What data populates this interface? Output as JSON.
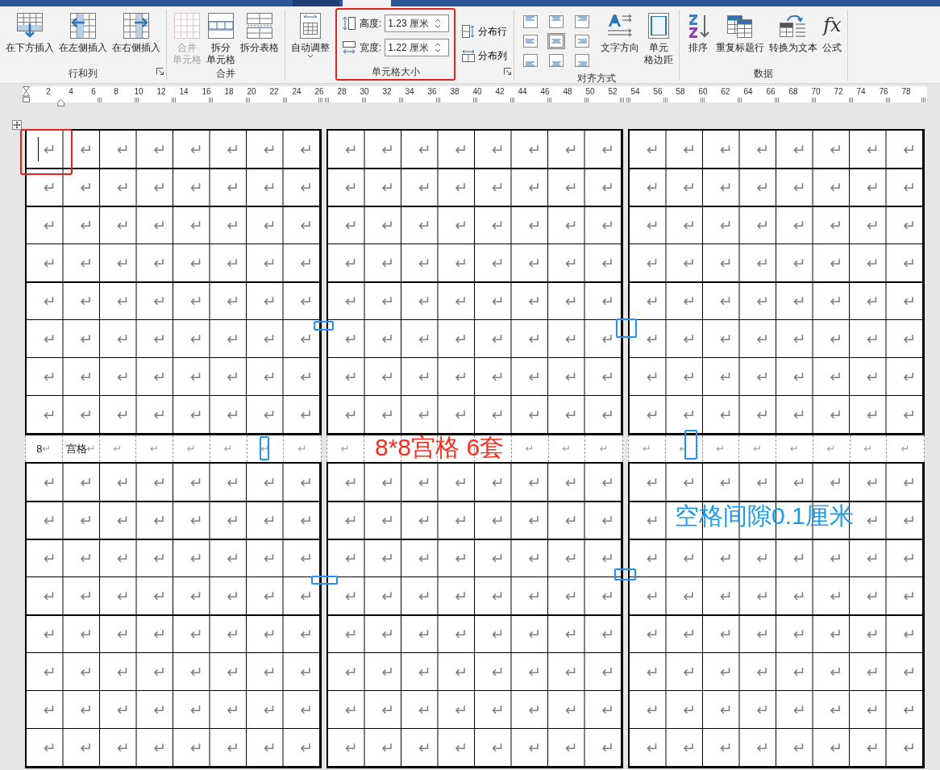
{
  "tab_strip": {
    "tabs": [
      {
        "selected": false
      },
      {
        "selected": true
      }
    ]
  },
  "ribbon": {
    "groups": [
      {
        "kind": "buttons",
        "label": "行和列",
        "launcher": true,
        "buttons": [
          {
            "kind": "insert_below",
            "label": "在下方插入",
            "disabled": false
          },
          {
            "kind": "insert_left",
            "label": "在左侧插入",
            "disabled": false
          },
          {
            "kind": "insert_right",
            "label": "在右侧插入",
            "disabled": false
          }
        ]
      },
      {
        "kind": "buttons",
        "label": "合并",
        "buttons": [
          {
            "kind": "merge",
            "label": [
              "合并",
              "单元格"
            ],
            "disabled": true
          },
          {
            "kind": "split_cells",
            "label": [
              "拆分",
              "单元格"
            ],
            "disabled": false
          },
          {
            "kind": "split_table",
            "label": "拆分表格",
            "disabled": false
          }
        ]
      },
      {
        "kind": "cell_size",
        "label": "单元格大小",
        "launcher": true,
        "highlighted": true,
        "autofit": {
          "kind": "autofit",
          "label": "自动调整",
          "disabled": false
        },
        "fields": [
          {
            "kind": "height",
            "label": "高度:",
            "value": "1.23 厘米"
          },
          {
            "kind": "width",
            "label": "宽度:",
            "value": "1.22 厘米"
          }
        ],
        "distribute": [
          {
            "kind": "rows",
            "label": "分布行"
          },
          {
            "kind": "cols",
            "label": "分布列"
          }
        ]
      },
      {
        "kind": "alignment",
        "label": "对齐方式",
        "align_buttons": [
          {
            "selected": false
          },
          {
            "selected": false
          },
          {
            "selected": false
          },
          {
            "selected": false
          },
          {
            "selected": true
          },
          {
            "selected": false
          },
          {
            "selected": false
          },
          {
            "selected": false
          },
          {
            "selected": false
          }
        ],
        "buttons": [
          {
            "kind": "text_direction",
            "label": "文字方向",
            "disabled": false
          },
          {
            "kind": "cell_margins",
            "label": [
              "单元",
              "格边距"
            ],
            "disabled": false
          }
        ]
      },
      {
        "kind": "buttons",
        "label": "数据",
        "buttons": [
          {
            "kind": "sort",
            "label": "排序",
            "disabled": false
          },
          {
            "kind": "repeat_header",
            "label": "重复标题行",
            "disabled": false
          },
          {
            "kind": "convert",
            "label": "转换为文本",
            "disabled": false
          },
          {
            "kind": "formula",
            "label": "公式",
            "glyph": "fx",
            "disabled": false
          }
        ]
      }
    ]
  },
  "ruler": {
    "numbers": [
      "2",
      "4",
      "6",
      "8",
      "10",
      "12",
      "14",
      "16",
      "18",
      "20",
      "22",
      "24",
      "26",
      "28",
      "30",
      "32",
      "34",
      "36",
      "38",
      "40",
      "42",
      "44",
      "46",
      "48",
      "50",
      "52",
      "54",
      "56",
      "58",
      "60",
      "62",
      "64",
      "66",
      "68",
      "70",
      "72",
      "74",
      "76",
      "78"
    ]
  },
  "top_blocks": [
    {
      "cursor": true,
      "highlighted": true,
      "rows": [
        [
          "↵",
          "↵",
          "↵",
          "↵",
          "↵",
          "↵",
          "↵",
          "↵"
        ],
        [
          "↵",
          "↵",
          "↵",
          "↵",
          "↵",
          "↵",
          "↵",
          "↵"
        ],
        [
          "↵",
          "↵",
          "↵",
          "↵",
          "↵",
          "↵",
          "↵",
          "↵"
        ],
        [
          "↵",
          "↵",
          "↵",
          "↵",
          "↵",
          "↵",
          "↵",
          "↵"
        ],
        [
          "↵",
          "↵",
          "↵",
          "↵",
          "↵",
          "↵",
          "↵",
          "↵"
        ],
        [
          "↵",
          "↵",
          "↵",
          "↵",
          "↵",
          "↵",
          "↵",
          "↵"
        ],
        [
          "↵",
          "↵",
          "↵",
          "↵",
          "↵",
          "↵",
          "↵",
          "↵"
        ],
        [
          "↵",
          "↵",
          "↵",
          "↵",
          "↵",
          "↵",
          "↵",
          "↵"
        ]
      ]
    },
    {
      "rows": [
        [
          "↵",
          "↵",
          "↵",
          "↵",
          "↵",
          "↵",
          "↵",
          "↵"
        ],
        [
          "↵",
          "↵",
          "↵",
          "↵",
          "↵",
          "↵",
          "↵",
          "↵"
        ],
        [
          "↵",
          "↵",
          "↵",
          "↵",
          "↵",
          "↵",
          "↵",
          "↵"
        ],
        [
          "↵",
          "↵",
          "↵",
          "↵",
          "↵",
          "↵",
          "↵",
          "↵"
        ],
        [
          "↵",
          "↵",
          "↵",
          "↵",
          "↵",
          "↵",
          "↵",
          "↵"
        ],
        [
          "↵",
          "↵",
          "↵",
          "↵",
          "↵",
          "↵",
          "↵",
          "↵"
        ],
        [
          "↵",
          "↵",
          "↵",
          "↵",
          "↵",
          "↵",
          "↵",
          "↵"
        ],
        [
          "↵",
          "↵",
          "↵",
          "↵",
          "↵",
          "↵",
          "↵",
          "↵"
        ]
      ]
    },
    {
      "rows": [
        [
          "↵",
          "↵",
          "↵",
          "↵",
          "↵",
          "↵",
          "↵",
          "↵"
        ],
        [
          "↵",
          "↵",
          "↵",
          "↵",
          "↵",
          "↵",
          "↵",
          "↵"
        ],
        [
          "↵",
          "↵",
          "↵",
          "↵",
          "↵",
          "↵",
          "↵",
          "↵"
        ],
        [
          "↵",
          "↵",
          "↵",
          "↵",
          "↵",
          "↵",
          "↵",
          "↵"
        ],
        [
          "↵",
          "↵",
          "↵",
          "↵",
          "↵",
          "↵",
          "↵",
          "↵"
        ],
        [
          "↵",
          "↵",
          "↵",
          "↵",
          "↵",
          "↵",
          "↵",
          "↵"
        ],
        [
          "↵",
          "↵",
          "↵",
          "↵",
          "↵",
          "↵",
          "↵",
          "↵"
        ],
        [
          "↵",
          "↵",
          "↵",
          "↵",
          "↵",
          "↵",
          "↵",
          "↵"
        ]
      ]
    }
  ],
  "middle_row": {
    "segments": [
      [
        {
          "kind": "text",
          "text": "8",
          "mark": "↵"
        },
        {
          "kind": "text",
          "text": "宫格",
          "mark": "↵"
        },
        {
          "kind": "mark",
          "mark": "↵"
        },
        {
          "kind": "mark",
          "mark": "↵"
        },
        {
          "kind": "mark",
          "mark": "↵"
        },
        {
          "kind": "mark",
          "mark": "↵"
        },
        {
          "kind": "mark",
          "mark": "↵"
        },
        {
          "kind": "mark",
          "mark": "↵"
        }
      ],
      [
        {
          "kind": "mark",
          "mark": "↵"
        },
        {
          "kind": "blank"
        },
        {
          "kind": "blank"
        },
        {
          "kind": "blank"
        },
        {
          "kind": "blank"
        },
        {
          "kind": "mark",
          "mark": "↵"
        },
        {
          "kind": "mark",
          "mark": "↵"
        },
        {
          "kind": "mark",
          "mark": "↵"
        }
      ],
      [
        {
          "kind": "mark",
          "mark": "↵"
        },
        {
          "kind": "mark",
          "mark": "↵"
        },
        {
          "kind": "mark",
          "mark": "↵"
        },
        {
          "kind": "mark",
          "mark": "↵"
        },
        {
          "kind": "mark",
          "mark": "↵"
        },
        {
          "kind": "mark",
          "mark": "↵"
        },
        {
          "kind": "mark",
          "mark": "↵"
        },
        {
          "kind": "mark",
          "mark": "↵"
        }
      ]
    ]
  },
  "bottom_blocks": [
    {
      "rows": [
        [
          "↵",
          "↵",
          "↵",
          "↵",
          "↵",
          "↵",
          "↵",
          "↵"
        ],
        [
          "↵",
          "↵",
          "↵",
          "↵",
          "↵",
          "↵",
          "↵",
          "↵"
        ],
        [
          "↵",
          "↵",
          "↵",
          "↵",
          "↵",
          "↵",
          "↵",
          "↵"
        ],
        [
          "↵",
          "↵",
          "↵",
          "↵",
          "↵",
          "↵",
          "↵",
          "↵"
        ],
        [
          "↵",
          "↵",
          "↵",
          "↵",
          "↵",
          "↵",
          "↵",
          "↵"
        ],
        [
          "↵",
          "↵",
          "↵",
          "↵",
          "↵",
          "↵",
          "↵",
          "↵"
        ],
        [
          "↵",
          "↵",
          "↵",
          "↵",
          "↵",
          "↵",
          "↵",
          "↵"
        ],
        [
          "↵",
          "↵",
          "↵",
          "↵",
          "↵",
          "↵",
          "↵",
          "↵"
        ]
      ]
    },
    {
      "rows": [
        [
          "↵",
          "↵",
          "↵",
          "↵",
          "↵",
          "↵",
          "↵",
          "↵"
        ],
        [
          "↵",
          "↵",
          "↵",
          "↵",
          "↵",
          "↵",
          "↵",
          "↵"
        ],
        [
          "↵",
          "↵",
          "↵",
          "↵",
          "↵",
          "↵",
          "↵",
          "↵"
        ],
        [
          "↵",
          "↵",
          "↵",
          "↵",
          "↵",
          "↵",
          "↵",
          "↵"
        ],
        [
          "↵",
          "↵",
          "↵",
          "↵",
          "↵",
          "↵",
          "↵",
          "↵"
        ],
        [
          "↵",
          "↵",
          "↵",
          "↵",
          "↵",
          "↵",
          "↵",
          "↵"
        ],
        [
          "↵",
          "↵",
          "↵",
          "↵",
          "↵",
          "↵",
          "↵",
          "↵"
        ],
        [
          "↵",
          "↵",
          "↵",
          "↵",
          "↵",
          "↵",
          "↵",
          "↵"
        ]
      ]
    },
    {
      "rows": [
        [
          "↵",
          "↵",
          "↵",
          "↵",
          "↵",
          "↵",
          "↵",
          "↵"
        ],
        [
          "↵",
          null,
          null,
          null,
          null,
          null,
          "↵",
          "↵"
        ],
        [
          "↵",
          "↵",
          "↵",
          "↵",
          "↵",
          "↵",
          "↵",
          "↵"
        ],
        [
          "↵",
          "↵",
          "↵",
          "↵",
          "↵",
          "↵",
          "↵",
          "↵"
        ],
        [
          "↵",
          "↵",
          "↵",
          "↵",
          "↵",
          "↵",
          "↵",
          "↵"
        ],
        [
          "↵",
          "↵",
          "↵",
          "↵",
          "↵",
          "↵",
          "↵",
          "↵"
        ],
        [
          "↵",
          "↵",
          "↵",
          "↵",
          "↵",
          "↵",
          "↵",
          "↵"
        ],
        [
          "↵",
          "↵",
          "↵",
          "↵",
          "↵",
          "↵",
          "↵",
          "↵"
        ]
      ]
    }
  ],
  "gap_marks": [
    {
      "kind": "wide"
    },
    {
      "kind": "wide"
    },
    {
      "kind": "tall"
    },
    {
      "kind": "tall"
    },
    {
      "kind": "wide"
    },
    {
      "kind": "wide"
    }
  ],
  "annotations": [
    {
      "kind": "title",
      "text": "8*8宫格 6套",
      "color": "#ff2a1a"
    },
    {
      "kind": "note",
      "text": "空格间隙0.1厘米",
      "color": "#1e9be8"
    }
  ]
}
